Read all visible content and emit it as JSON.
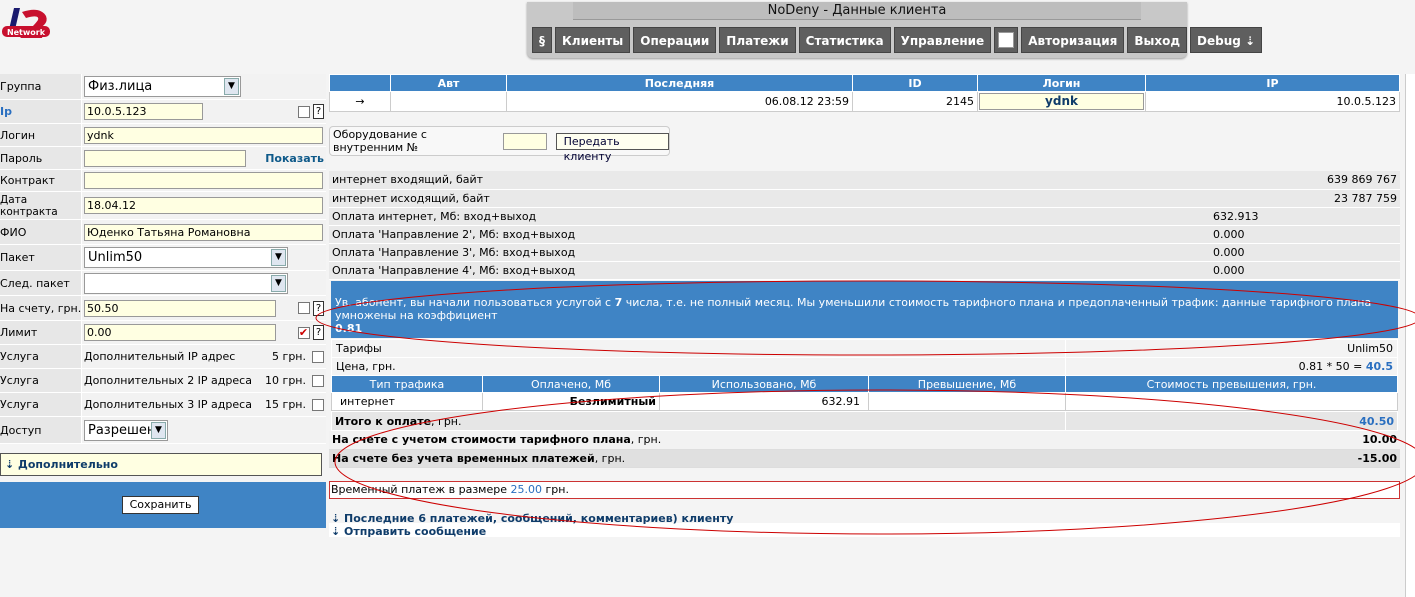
{
  "logo": {
    "text": "Network",
    "icon": "lan-logo-icon"
  },
  "header": {
    "title": "NoDeny - Данные клиента"
  },
  "menu": [
    "§",
    "Клиенты",
    "Операции",
    "Платежи",
    "Статистика",
    "Управление",
    "",
    "Авторизация",
    "Выход",
    "Debug ⇣"
  ],
  "form": {
    "group_label": "Группа",
    "group_value": "Физ.лица",
    "ip_label": "Ip",
    "ip_value": "10.0.5.123",
    "login_label": "Логин",
    "login_value": "ydnk",
    "password_label": "Пароль",
    "password_value": "",
    "show_link": "Показать",
    "contract_label": "Контракт",
    "contract_value": "",
    "contract_date_label": "Дата контракта",
    "contract_date_value": "18.04.12",
    "fio_label": "ФИО",
    "fio_value": "Юденко Татьяна Романовна",
    "package_label": "Пакет",
    "package_value": "Unlim50",
    "next_package_label": "След. пакет",
    "next_package_value": "",
    "balance_label": "На счету, грн.",
    "balance_value": "50.50",
    "limit_label": "Лимит",
    "limit_value": "0.00",
    "services": [
      {
        "label": "Услуга",
        "name": "Дополнительный IP адрес",
        "price": "5 грн."
      },
      {
        "label": "Услуга",
        "name": "Дополнительных 2 IP адреса",
        "price": "10 грн."
      },
      {
        "label": "Услуга",
        "name": "Дополнительных 3 IP адреса",
        "price": "15 грн."
      }
    ],
    "access_label": "Доступ",
    "access_value": "Разрешен",
    "extra": "⇣ Дополнительно",
    "save": "Сохранить"
  },
  "client_table": {
    "headers": [
      "",
      "Авт",
      "Последняя",
      "ID",
      "Логин",
      "IP"
    ],
    "row": {
      "arrow": "→",
      "auth": "",
      "last": "06.08.12 23:59",
      "id": "2145",
      "login": "ydnk",
      "ip": "10.0.5.123"
    }
  },
  "equipment": {
    "label": "Оборудование с внутренним №",
    "value": "",
    "button": "Передать клиенту"
  },
  "stats": [
    {
      "label": "интернет входящий, байт",
      "value": "639 869 767"
    },
    {
      "label": "интернет исходящий, байт",
      "value": "23 787 759"
    },
    {
      "label": "Оплата интернет, Мб: вход+выход",
      "value": "632.913"
    },
    {
      "label": "Оплата 'Направление 2', Мб: вход+выход",
      "value": "0.000"
    },
    {
      "label": "Оплата 'Направление 3', Мб: вход+выход",
      "value": "0.000"
    },
    {
      "label": "Оплата 'Направление 4', Мб: вход+выход",
      "value": "0.000"
    }
  ],
  "notice": {
    "text_a": "Ув. абонент, вы начали пользоваться услугой с ",
    "day": "7",
    "text_b": " числа, т.е. не полный месяц. Мы уменьшили стоимость тарифного плана и предоплаченный трафик: данные тарифного плана умножены на коэффициент",
    "coef": "0.81"
  },
  "tariff": {
    "label": "Тарифы",
    "value": "Unlim50",
    "price_label": "Цена, грн.",
    "price_formula": "0.81 * 50 = ",
    "price_value": "40.5"
  },
  "traffic": {
    "headers": [
      "Тип трафика",
      "Оплачено, Мб",
      "Использовано, Мб",
      "Превышение, Мб",
      "Стоимость превышения, грн."
    ],
    "row": [
      "интернет",
      "Безлимитный",
      "632.91",
      "",
      ""
    ]
  },
  "total": {
    "label_bold": "Итого к оплате",
    "label_rest": ", грн.",
    "value": "40.50"
  },
  "balance_rows": [
    {
      "bold": "На счете с учетом стоимости тарифного плана",
      "rest": ", грн.",
      "value": "10.00"
    },
    {
      "bold": "На счете без учета временных платежей",
      "rest": ", грн.",
      "value": "-15.00"
    }
  ],
  "temp_payment": {
    "text": "Временный платеж в размере ",
    "amount": "25.00",
    "unit": " грн."
  },
  "links": {
    "payments": "⇣ Последние 6 платежей, сообщений, комментариев) клиенту",
    "send": "⇣ Отправить сообщение"
  },
  "colors": {
    "header_blue": "#3f84c5",
    "input_yellow": "#ffffe2",
    "annotation_red": "#cc0000"
  }
}
